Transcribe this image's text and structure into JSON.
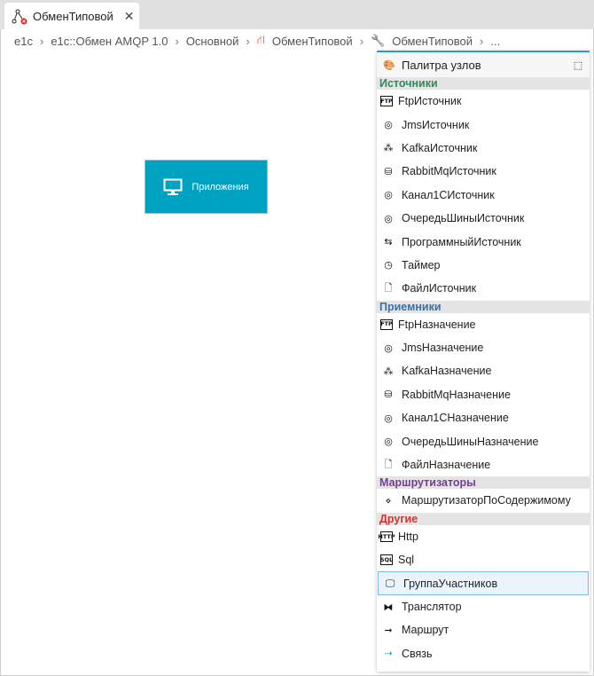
{
  "tab": {
    "label": "ОбменТиповой",
    "icon": "graph-error-icon"
  },
  "breadcrumb": [
    "e1c",
    "e1c::Обмен AMQP 1.0",
    "Основной",
    "ОбменТиповой",
    "ОбменТиповой",
    "..."
  ],
  "canvas": {
    "node_label": "Приложения",
    "node_color": "#00a2c2"
  },
  "palette": {
    "title": "Палитра узлов",
    "sections": [
      {
        "title": "Источники",
        "color": "#2e8b57",
        "items": [
          {
            "label": "FtpИсточник",
            "icon": "FTP"
          },
          {
            "label": "JmsИсточник",
            "icon": "◎"
          },
          {
            "label": "KafkaИсточник",
            "icon": "⁂"
          },
          {
            "label": "RabbitMqИсточник",
            "icon": "⛁"
          },
          {
            "label": "Канал1СИсточник",
            "icon": "◎"
          },
          {
            "label": "ОчередьШиныИсточник",
            "icon": "◎"
          },
          {
            "label": "ПрограммныйИсточник",
            "icon": "⇆"
          },
          {
            "label": "Таймер",
            "icon": "◷"
          },
          {
            "label": "ФайлИсточник",
            "icon": "🗋"
          }
        ]
      },
      {
        "title": "Приемники",
        "color": "#3b6fa8",
        "items": [
          {
            "label": "FtpНазначение",
            "icon": "FTP"
          },
          {
            "label": "JmsНазначение",
            "icon": "◎"
          },
          {
            "label": "KafkaНазначение",
            "icon": "⁂"
          },
          {
            "label": "RabbitMqНазначение",
            "icon": "⛁"
          },
          {
            "label": "Канал1СНазначение",
            "icon": "◎"
          },
          {
            "label": "ОчередьШиныНазначение",
            "icon": "◎"
          },
          {
            "label": "ФайлНазначение",
            "icon": "🗋"
          }
        ]
      },
      {
        "title": "Маршрутизаторы",
        "color": "#7a3d96",
        "items": [
          {
            "label": "МаршрутизаторПоСодержимому",
            "icon": "⋄"
          }
        ]
      },
      {
        "title": "Другие",
        "color": "#d03333",
        "items": [
          {
            "label": "Http",
            "icon": "HTTP"
          },
          {
            "label": "Sql",
            "icon": "SQL"
          },
          {
            "label": "ГруппаУчастников",
            "icon": "🖵",
            "selected": true
          },
          {
            "label": "Транслятор",
            "icon": "⧓"
          },
          {
            "label": "Маршрут",
            "icon": "➞"
          },
          {
            "label": "Связь",
            "icon": "⇢"
          }
        ]
      }
    ]
  }
}
